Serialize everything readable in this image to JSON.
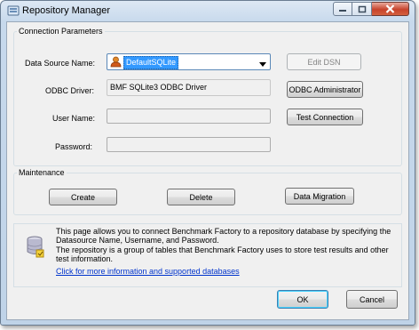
{
  "window": {
    "title": "Repository Manager"
  },
  "connection": {
    "group_title": "Connection Parameters",
    "dsn_label": "Data Source Name:",
    "dsn_value": "DefaultSQLite",
    "edit_dsn_label": "Edit DSN",
    "driver_label": "ODBC Driver:",
    "driver_value": "BMF SQLite3 ODBC Driver",
    "odbc_admin_label": "ODBC Administrator",
    "user_label": "User Name:",
    "user_value": "",
    "test_connection_label": "Test Connection",
    "password_label": "Password:",
    "password_value": ""
  },
  "maintenance": {
    "group_title": "Maintenance",
    "create_label": "Create",
    "delete_label": "Delete",
    "migration_label": "Data Migration"
  },
  "info": {
    "line1": "This page allows you to connect Benchmark Factory to a repository database by specifying the Datasource Name, Username, and Password.",
    "line2": "The repository is a group of tables that Benchmark Factory uses to store test results and other test information.",
    "link": "Click for more information and supported databases"
  },
  "footer": {
    "ok_label": "OK",
    "cancel_label": "Cancel"
  },
  "icons": {
    "app": "repository-icon",
    "dsn": "user-db-icon",
    "info": "database-icon"
  },
  "colors": {
    "selection": "#3399ff",
    "link": "#0033cc",
    "close_button": "#c7432c"
  }
}
